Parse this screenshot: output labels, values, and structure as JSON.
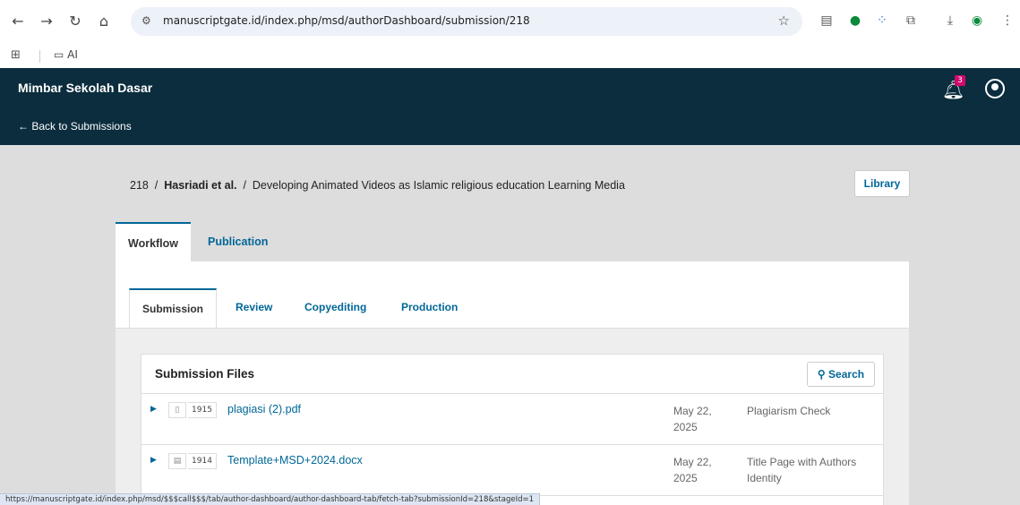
{
  "browser": {
    "url": "manuscriptgate.id/index.php/msd/authorDashboard/submission/218",
    "bookmark_folder": "AI",
    "status_url": "https://manuscriptgate.id/index.php/msd/$$$call$$$/tab/author-dashboard/author-dashboard-tab/fetch-tab?submissionId=218&stageId=1"
  },
  "header": {
    "journal_title": "Mimbar Sekolah Dasar",
    "back_link": "← Back to Submissions",
    "notification_count": "3"
  },
  "breadcrumb": {
    "id": "218",
    "authors": "Hasriadi et al.",
    "title": "Developing Animated Videos as Islamic religious education Learning Media"
  },
  "library_label": "Library",
  "main_tabs": [
    {
      "label": "Workflow",
      "active": true
    },
    {
      "label": "Publication",
      "active": false
    }
  ],
  "sub_tabs": [
    {
      "label": "Submission",
      "active": true
    },
    {
      "label": "Review",
      "active": false
    },
    {
      "label": "Copyediting",
      "active": false
    },
    {
      "label": "Production",
      "active": false
    }
  ],
  "files_panel": {
    "title": "Submission Files",
    "search_label": "Search",
    "rows": [
      {
        "id": "1915",
        "name": "plagiasi (2).pdf",
        "date": "May 22, 2025",
        "type": "Plagiarism Check"
      },
      {
        "id": "1914",
        "name": "Template+MSD+2024.docx",
        "date": "May 22, 2025",
        "type": "Title Page with Authors Identity"
      }
    ]
  }
}
